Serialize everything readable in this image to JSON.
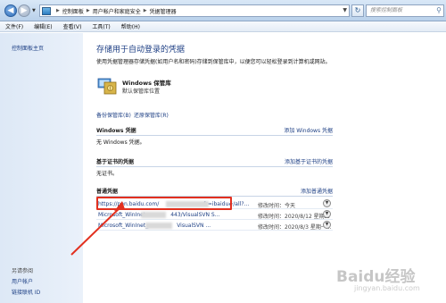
{
  "address": {
    "crumbs": [
      "控制面板",
      "用户帐户和家庭安全",
      "凭据管理器"
    ],
    "search_placeholder": "搜索控制面板"
  },
  "menu": [
    "文件(F)",
    "编辑(E)",
    "查看(V)",
    "工具(T)",
    "帮助(H)"
  ],
  "left": {
    "home": "控制面板主页",
    "see_also": "另请参阅",
    "links": [
      "用户帐户",
      "链接联机 ID"
    ]
  },
  "main": {
    "title": "存储用于自动登录的凭据",
    "description": "使用凭据管理器存储凭据(如用户名和密码)存储到保管库中，以便您可以轻松登录到计算机或网站。",
    "vault": {
      "name": "Windows 保管库",
      "subtitle": "默认保管库位置"
    },
    "backup_link": "备份保管库(B)",
    "restore_link": "还原保管库(R)",
    "windows_section": {
      "title": "Windows 凭据",
      "add": "添加 Windows 凭据",
      "empty": "无 Windows 凭据。"
    },
    "cert_section": {
      "title": "基于证书的凭据",
      "add": "添加基于证书的凭据",
      "empty": "无证书。"
    },
    "generic_section": {
      "title": "普通凭据",
      "add": "添加普通凭据"
    },
    "credentials": [
      {
        "name": "https://pan.baidu.com/",
        "name_tail": "fr=ibaidu#/all?...",
        "modified": "修改时间：今天"
      },
      {
        "name": "Microsoft_WinInet",
        "name_tail": "443/VisualSVN S...",
        "modified": "修改时间：2020/8/12 星期三"
      },
      {
        "name": "Microsoft_WinInet_",
        "name_tail": "VisualSVN ...",
        "modified": "修改时间：2020/8/3 星期一..."
      }
    ]
  },
  "watermark": {
    "brand": "Baidu经验",
    "url": "jingyan.baidu.com"
  },
  "colors": {
    "highlight": "#e2301f",
    "link": "#1d3f84",
    "title": "#1e3f84"
  }
}
